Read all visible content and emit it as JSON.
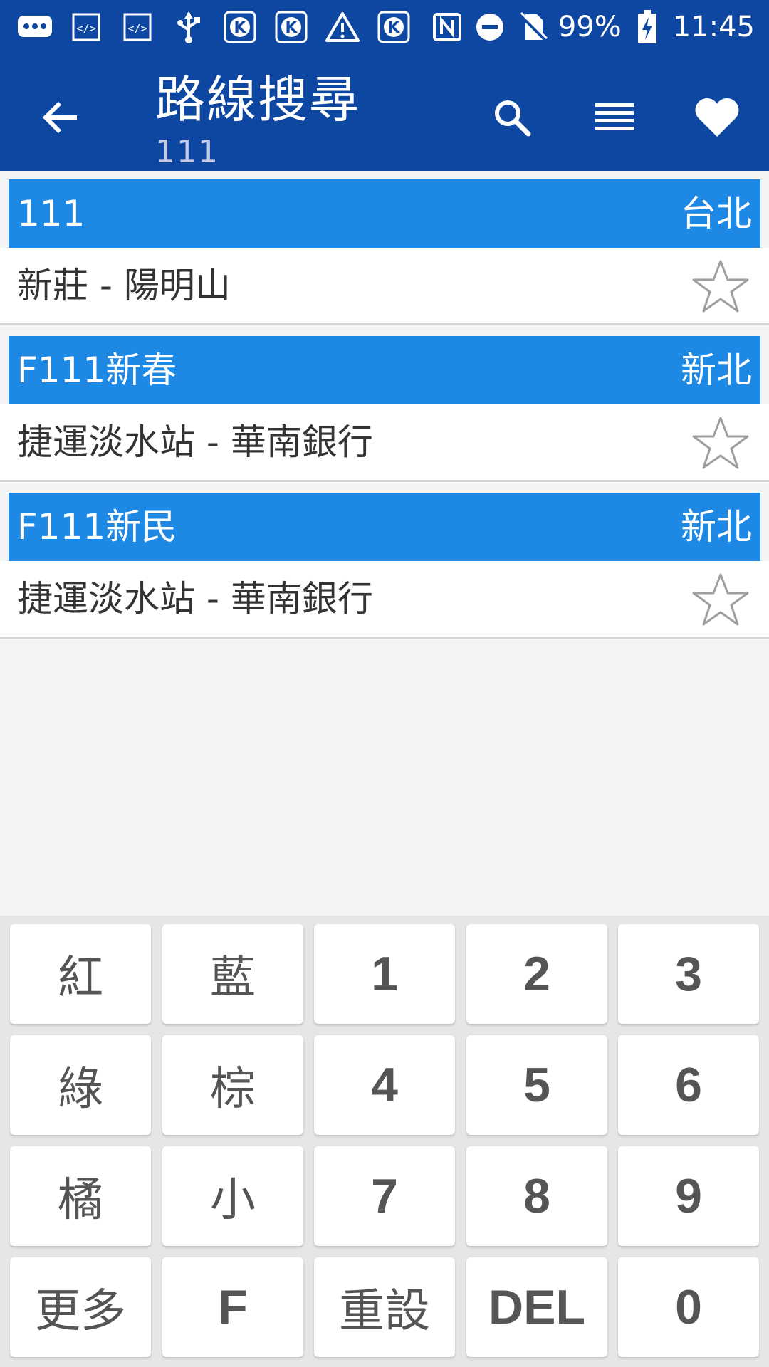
{
  "status_bar": {
    "battery": "99%",
    "time": "11:45",
    "icons_left": [
      "chat-icon",
      "code-icon",
      "code-icon",
      "usb-icon",
      "k-app-icon",
      "k-app-icon",
      "warning-icon",
      "k-app-icon"
    ],
    "icons_right": [
      "nfc-icon",
      "dnd-icon",
      "no-sim-icon",
      "battery-charging-icon"
    ]
  },
  "app_bar": {
    "title": "路線搜尋",
    "subtitle": "111",
    "actions": [
      "search-icon",
      "list-icon",
      "favorite-heart-icon"
    ]
  },
  "routes": [
    {
      "number": "111",
      "city": "台北",
      "description": "新莊 - 陽明山"
    },
    {
      "number": "F111新春",
      "city": "新北",
      "description": "捷運淡水站 - 華南銀行"
    },
    {
      "number": "F111新民",
      "city": "新北",
      "description": "捷運淡水站 - 華南銀行"
    }
  ],
  "keypad": {
    "rows": [
      [
        "紅",
        "藍",
        "1",
        "2",
        "3"
      ],
      [
        "綠",
        "棕",
        "4",
        "5",
        "6"
      ],
      [
        "橘",
        "小",
        "7",
        "8",
        "9"
      ],
      [
        "更多",
        "F",
        "重設",
        "DEL",
        "0"
      ]
    ]
  },
  "colors": {
    "primary_dark": "#0d47a1",
    "route_header": "#1e88e5",
    "background": "#f4f4f4"
  }
}
